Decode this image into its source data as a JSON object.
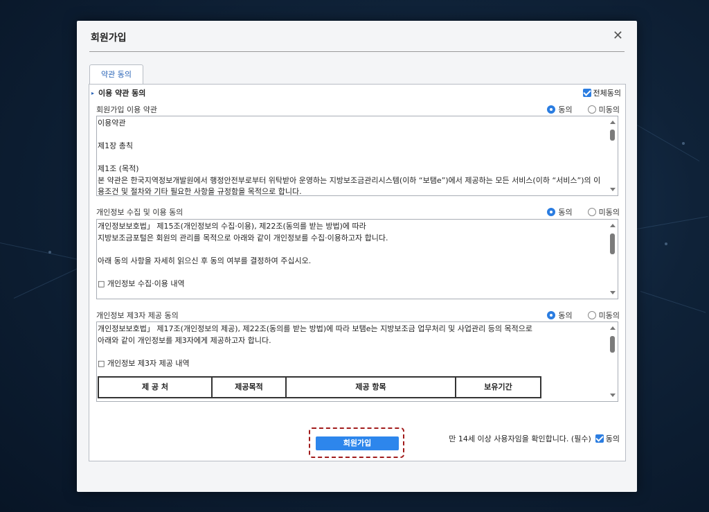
{
  "dialog": {
    "title": "회원가입"
  },
  "tab": {
    "label": "약관 동의"
  },
  "section": {
    "title": "이용 약관 동의",
    "all_agree_label": "전체동의"
  },
  "radio_labels": {
    "agree": "동의",
    "disagree": "미동의"
  },
  "terms": [
    {
      "label": "회원가입 이용 약관",
      "selected": "agree",
      "lines": [
        "이용약관",
        "",
        "제1장 총칙",
        "",
        "제1조 (목적)",
        "본 약관은 한국지역정보개발원에서 행정안전부로부터 위탁받아 운영하는 지방보조금관리시스템(이하 “보탬e”)에서 제공하는 모든 서비스(이하 “서비스”)의 이",
        "용조건 및 절차와 기타 필요한 사항을 규정함을 목적으로 합니다."
      ]
    },
    {
      "label": "개인정보 수집 및 이용 동의",
      "selected": "agree",
      "lines": [
        "개인정보보호법」 제15조(개인정보의 수집·이용), 제22조(동의를 받는 방법)에 따라",
        "지방보조금포털은 회원의 관리를 목적으로 아래와 같이 개인정보를 수집·이용하고자 합니다.",
        "",
        "아래 동의 사항을 자세히 읽으신 후 동의 여부를 결정하여 주십시오.",
        "",
        "□ 개인정보 수집·이용 내역"
      ]
    },
    {
      "label": "개인정보 제3자 제공 동의",
      "selected": "agree",
      "lines": [
        "개인정보보호법」 제17조(개인정보의 제공), 제22조(동의를 받는 방법)에 따라 보탬e는 지방보조금 업무처리 및 사업관리 등의 목적으로",
        "아래와 같이 개인정보를 제3자에게 제공하고자 합니다.",
        "",
        "□ 개인정보 제3자 제공 내역"
      ],
      "table_headers": [
        "제 공 처",
        "제공목적",
        "제공 항목",
        "보유기간"
      ]
    }
  ],
  "age_confirm": {
    "text": "만 14세 이상 사용자임을 확인합니다. (필수)",
    "check_label": "동의"
  },
  "join_button": {
    "label": "회원가입"
  }
}
